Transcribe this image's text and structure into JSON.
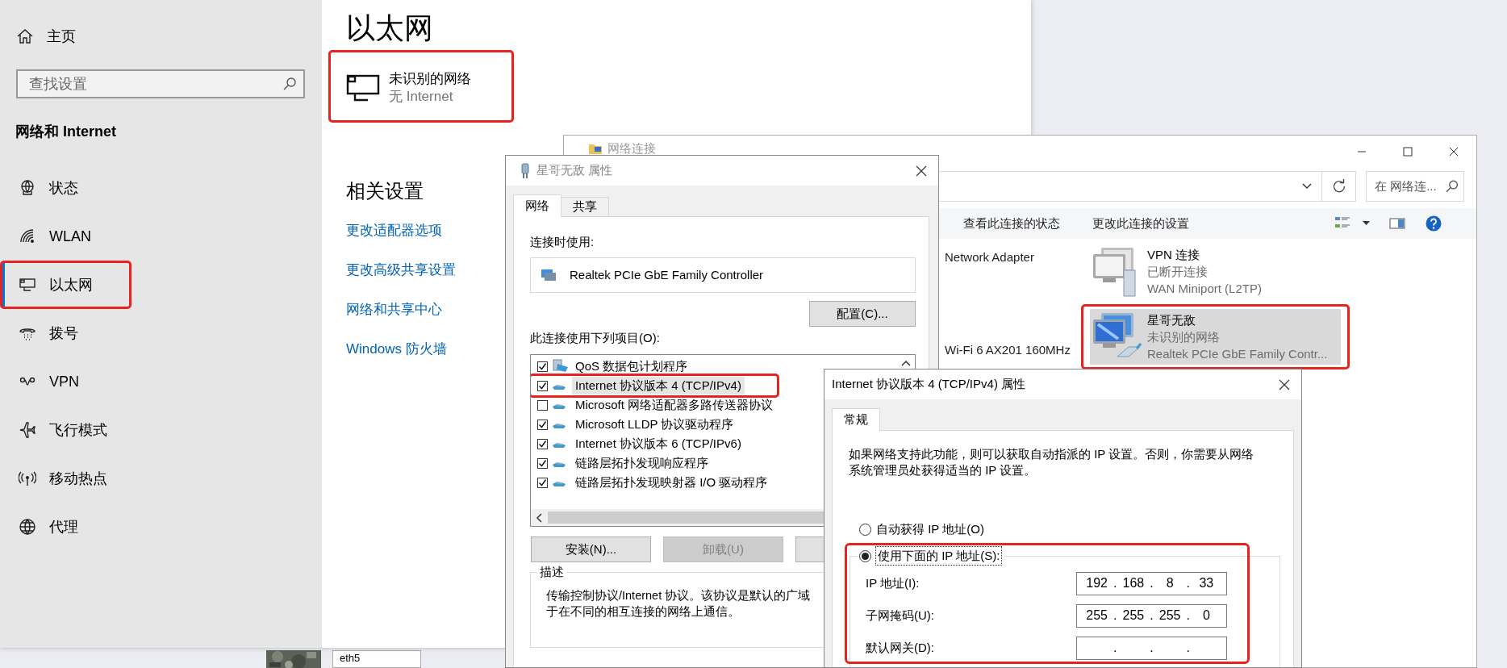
{
  "settings": {
    "home": "主页",
    "search": {
      "placeholder": "查找设置"
    },
    "section_title": "网络和 Internet",
    "nav_items": [
      {
        "label": "状态",
        "selected": false,
        "highlighted": false
      },
      {
        "label": "WLAN",
        "selected": false,
        "highlighted": false
      },
      {
        "label": "以太网",
        "selected": true,
        "highlighted": true
      },
      {
        "label": "拨号",
        "selected": false,
        "highlighted": false
      },
      {
        "label": "VPN",
        "selected": false,
        "highlighted": false
      },
      {
        "label": "飞行模式",
        "selected": false,
        "highlighted": false
      },
      {
        "label": "移动热点",
        "selected": false,
        "highlighted": false
      },
      {
        "label": "代理",
        "selected": false,
        "highlighted": false
      }
    ],
    "page_title": "以太网",
    "network": {
      "name": "未识别的网络",
      "status": "无 Internet",
      "highlighted": true
    },
    "related_title": "相关设置",
    "related_links": [
      "更改适配器选项",
      "更改高级共享设置",
      "网络和共享中心",
      "Windows 防火墙"
    ]
  },
  "connections_window": {
    "title": "网络连接",
    "search": {
      "placeholder": "在 网络连..."
    },
    "toolbar": [
      "查看此连接的状态",
      "更改此连接的设置"
    ],
    "partial_items": [
      "Network Adapter",
      "Wi-Fi 6 AX201 160MHz"
    ],
    "items": [
      {
        "kind": "vpn",
        "name": "VPN 连接",
        "status": "已断开连接",
        "device": "WAN Miniport (L2TP)",
        "selected": false,
        "highlighted": false
      },
      {
        "kind": "ethernet",
        "name": "星哥无敌",
        "status": "未识别的网络",
        "device": "Realtek PCIe GbE Family Contr...",
        "selected": true,
        "highlighted": true
      }
    ]
  },
  "properties_dialog": {
    "title": "星哥无敌 属性",
    "tabs": [
      {
        "label": "网络",
        "selected": true
      },
      {
        "label": "共享",
        "selected": false
      }
    ],
    "connect_using_label": "连接时使用:",
    "adapter": "Realtek PCIe GbE Family Controller",
    "configure_button": "配置(C)...",
    "items_label": "此连接使用下列项目(O):",
    "items": [
      {
        "kind": "service",
        "label": "QoS 数据包计划程序",
        "checked": true,
        "selected": false,
        "highlighted": false
      },
      {
        "kind": "protocol",
        "label": "Internet 协议版本 4 (TCP/IPv4)",
        "checked": true,
        "selected": true,
        "highlighted": true
      },
      {
        "kind": "protocol",
        "label": "Microsoft 网络适配器多路传送器协议",
        "checked": false,
        "selected": false,
        "highlighted": false
      },
      {
        "kind": "protocol",
        "label": "Microsoft LLDP 协议驱动程序",
        "checked": true,
        "selected": false,
        "highlighted": false
      },
      {
        "kind": "protocol",
        "label": "Internet 协议版本 6 (TCP/IPv6)",
        "checked": true,
        "selected": false,
        "highlighted": false
      },
      {
        "kind": "protocol",
        "label": "链路层拓扑发现响应程序",
        "checked": true,
        "selected": false,
        "highlighted": false
      },
      {
        "kind": "protocol",
        "label": "链路层拓扑发现映射器 I/O 驱动程序",
        "checked": true,
        "selected": false,
        "highlighted": false
      }
    ],
    "buttons": [
      {
        "label": "安装(N)...",
        "disabled": false
      },
      {
        "label": "卸载(U)",
        "disabled": true
      }
    ],
    "description_title": "描述",
    "description_lines": [
      "传输控制协议/Internet 协议。该协议是默认的广域",
      "于在不同的相互连接的网络上通信。"
    ]
  },
  "ipv4_dialog": {
    "title": "Internet 协议版本 4 (TCP/IPv4) 属性",
    "tabs": [
      {
        "label": "常规",
        "selected": true
      }
    ],
    "description": "如果网络支持此功能，则可以获取自动指派的 IP 设置。否则，你需要从网络系统管理员处获得适当的 IP 设置。",
    "radios": [
      {
        "label": "自动获得 IP 地址(O)",
        "selected": false
      },
      {
        "label": "使用下面的 IP 地址(S):",
        "selected": true
      }
    ],
    "manual_highlighted": true,
    "fields": [
      {
        "label": "IP 地址(I):",
        "octets": [
          "192",
          "168",
          "8",
          "33"
        ],
        "separators": [
          ".",
          ".",
          "."
        ]
      },
      {
        "label": "子网掩码(U):",
        "octets": [
          "255",
          "255",
          "255",
          "0"
        ],
        "separators": [
          ".",
          ".",
          "."
        ]
      },
      {
        "label": "默认网关(D):",
        "separators": [
          ".",
          ".",
          "."
        ]
      }
    ]
  },
  "desktop": {
    "field_value": "eth5"
  }
}
